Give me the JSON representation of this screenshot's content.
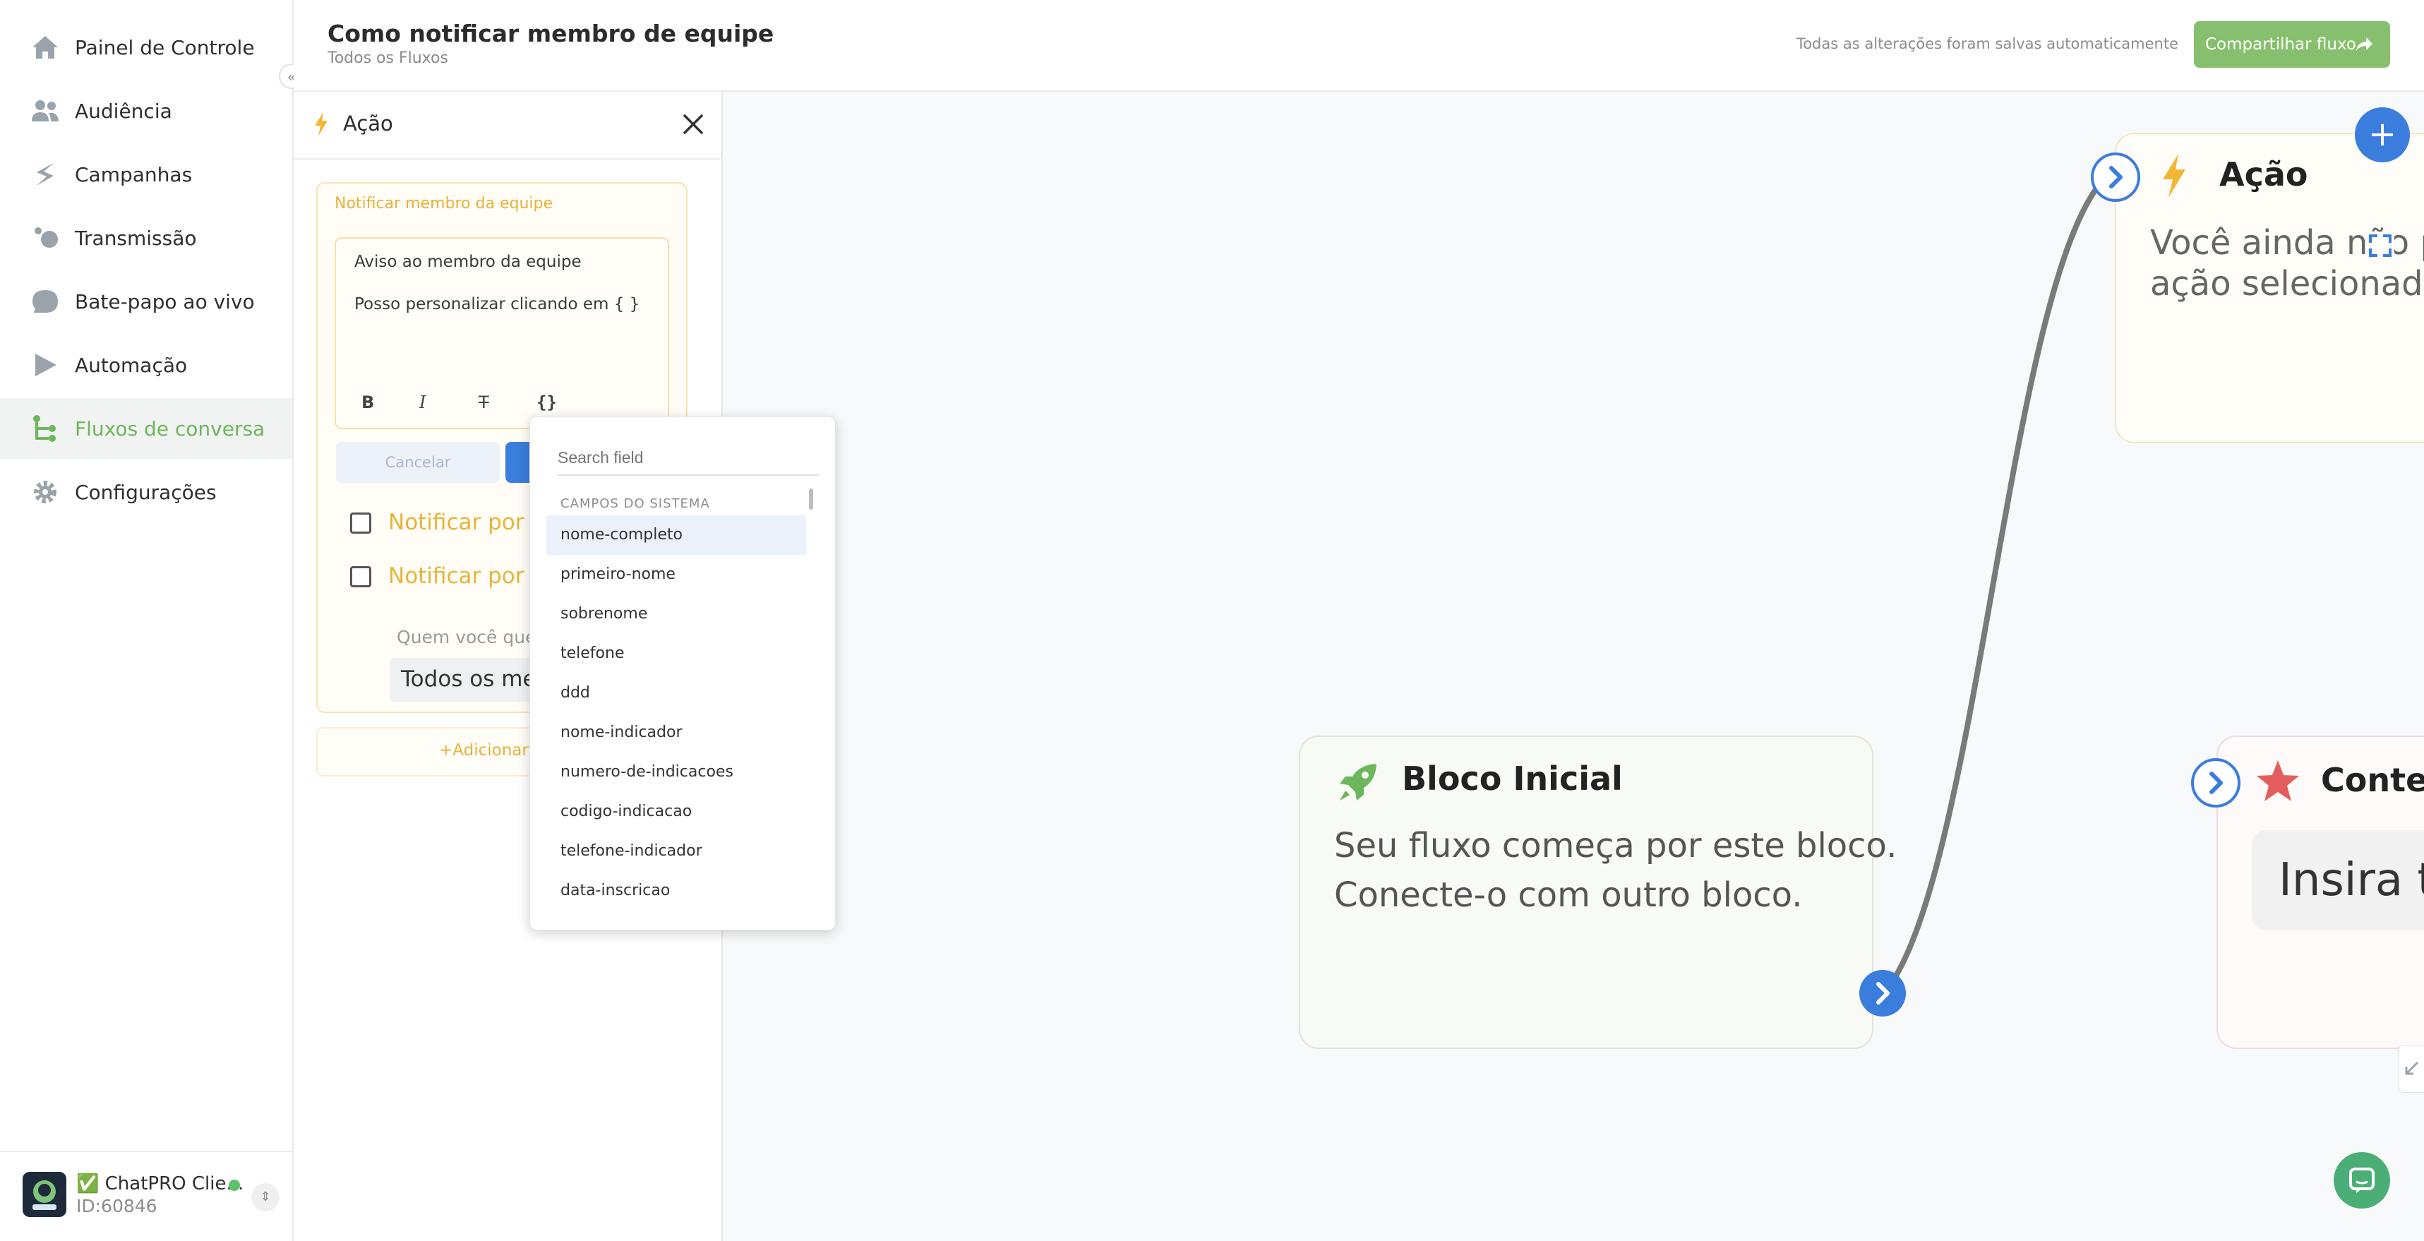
{
  "sidebar": {
    "items": [
      {
        "label": "Painel de Controle",
        "icon": "home-icon"
      },
      {
        "label": "Audiência",
        "icon": "users-icon"
      },
      {
        "label": "Campanhas",
        "icon": "campaign-icon"
      },
      {
        "label": "Transmissão",
        "icon": "broadcast-icon"
      },
      {
        "label": "Bate-papo ao vivo",
        "icon": "chat-bubble-icon"
      },
      {
        "label": "Automação",
        "icon": "play-icon"
      },
      {
        "label": "Fluxos de conversa",
        "icon": "flow-icon",
        "active": true
      },
      {
        "label": "Configurações",
        "icon": "gear-icon"
      }
    ],
    "collapse_glyph": "«",
    "account": {
      "name": "✅ ChatPRO Clie...",
      "id": "ID:60846",
      "switch_glyph": "⇕"
    }
  },
  "header": {
    "title": "Como notificar membro de equipe",
    "breadcrumb": "Todos os Fluxos",
    "autosave": "Todas as alterações foram salvas automaticamente",
    "share_label": "Compartilhar fluxo"
  },
  "panel": {
    "title": "Ação",
    "card_title": "Notificar membro da equipe",
    "editor_line1": "Aviso ao membro da equipe",
    "editor_line2": "Posso personalizar clicando em { }",
    "format_buttons": {
      "bold": "B",
      "italic": "I",
      "strike": "T",
      "variable": "{}"
    },
    "cancel_label": "Cancelar",
    "notify_whatsapp": "Notificar por W",
    "notify_email": "Notificar por E",
    "who_label": "Quem você quer",
    "member_value": "Todos os me",
    "add_action_label": "+Adicionar a"
  },
  "field_dropdown": {
    "placeholder": "Search field",
    "group_label": "CAMPOS DO SISTEMA",
    "highlighted_index": 0,
    "fields": [
      "nome-completo",
      "primeiro-nome",
      "sobrenome",
      "telefone",
      "ddd",
      "nome-indicador",
      "numero-de-indicacoes",
      "codigo-indicacao",
      "telefone-indicador",
      "data-inscricao"
    ]
  },
  "canvas": {
    "start_node": {
      "title": "Bloco Inicial",
      "desc_line1": "Seu fluxo começa por este bloco.",
      "desc_line2": "Conecte-o com outro bloco."
    },
    "action_node": {
      "title": "Ação",
      "desc_line1": "Você ainda não po",
      "desc_line2": "ação selecionada"
    },
    "content_node": {
      "title": "Conteú",
      "input_text": "Insira te"
    },
    "add_glyph": "+"
  },
  "colors": {
    "accent_green": "#6db65b",
    "accent_blue": "#3b7ddd",
    "action_yellow": "#e8b13a",
    "share_green": "#86c06e",
    "star_red": "#e35d5d"
  }
}
